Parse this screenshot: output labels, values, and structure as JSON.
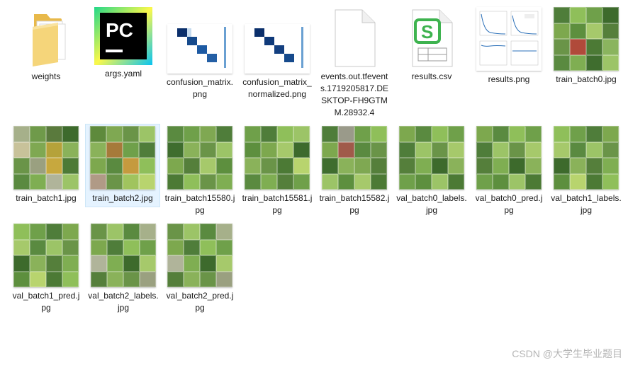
{
  "files": [
    {
      "name": "weights",
      "type": "folder"
    },
    {
      "name": "args.yaml",
      "type": "pycharm"
    },
    {
      "name": "confusion_matrix.png",
      "type": "confusion"
    },
    {
      "name": "confusion_matrix_normalized.png",
      "type": "confusion"
    },
    {
      "name": "events.out.tfevents.1719205817.DESKTOP-FH9GTMM.28932.4",
      "type": "blank"
    },
    {
      "name": "results.csv",
      "type": "spreadsheet"
    },
    {
      "name": "results.png",
      "type": "plots"
    },
    {
      "name": "train_batch0.jpg",
      "type": "batch"
    },
    {
      "name": "train_batch1.jpg",
      "type": "batch"
    },
    {
      "name": "train_batch2.jpg",
      "type": "batch",
      "selected": true
    },
    {
      "name": "train_batch15580.jpg",
      "type": "batch"
    },
    {
      "name": "train_batch15581.jpg",
      "type": "batch"
    },
    {
      "name": "train_batch15582.jpg",
      "type": "batch"
    },
    {
      "name": "val_batch0_labels.jpg",
      "type": "batch"
    },
    {
      "name": "val_batch0_pred.jpg",
      "type": "batch"
    },
    {
      "name": "val_batch1_labels.jpg",
      "type": "batch"
    },
    {
      "name": "val_batch1_pred.jpg",
      "type": "batch"
    },
    {
      "name": "val_batch2_labels.jpg",
      "type": "batch"
    },
    {
      "name": "val_batch2_pred.jpg",
      "type": "batch"
    }
  ],
  "watermark": "CSDN @大学生毕业题目"
}
